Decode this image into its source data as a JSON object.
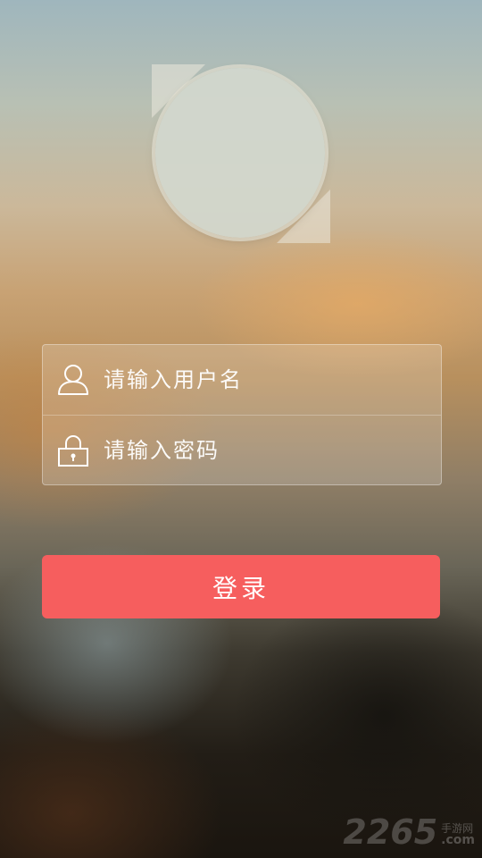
{
  "login": {
    "username_placeholder": "请输入用户名",
    "password_placeholder": "请输入密码",
    "login_button_label": "登录"
  },
  "icons": {
    "user": "user-icon",
    "lock": "lock-icon"
  },
  "colors": {
    "login_button": "#f65e5e",
    "text": "#ffffff"
  },
  "watermark": {
    "number": "2265",
    "site_cn": "手游网",
    "site_en": ".com"
  }
}
